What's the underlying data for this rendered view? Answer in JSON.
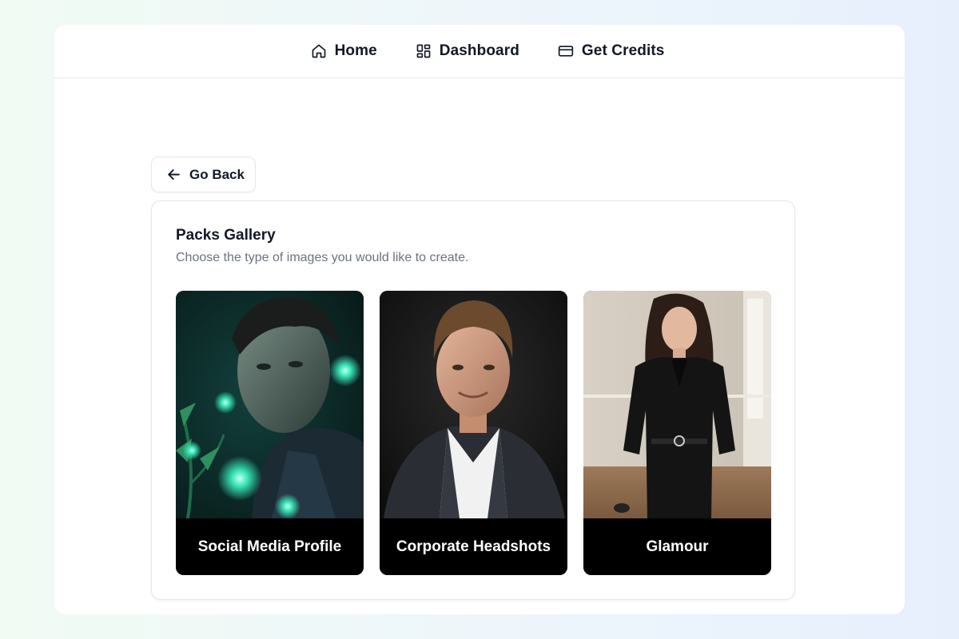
{
  "nav": {
    "items": [
      {
        "label": "Home",
        "icon": "home-icon"
      },
      {
        "label": "Dashboard",
        "icon": "dashboard-icon"
      },
      {
        "label": "Get Credits",
        "icon": "credit-card-icon"
      }
    ]
  },
  "back_button": {
    "label": "Go Back",
    "icon": "arrow-left-icon"
  },
  "gallery": {
    "title": "Packs Gallery",
    "subtitle": "Choose the type of images you would like to create.",
    "packs": [
      {
        "label": "Social Media Profile"
      },
      {
        "label": "Corporate Headshots"
      },
      {
        "label": "Glamour"
      }
    ]
  }
}
